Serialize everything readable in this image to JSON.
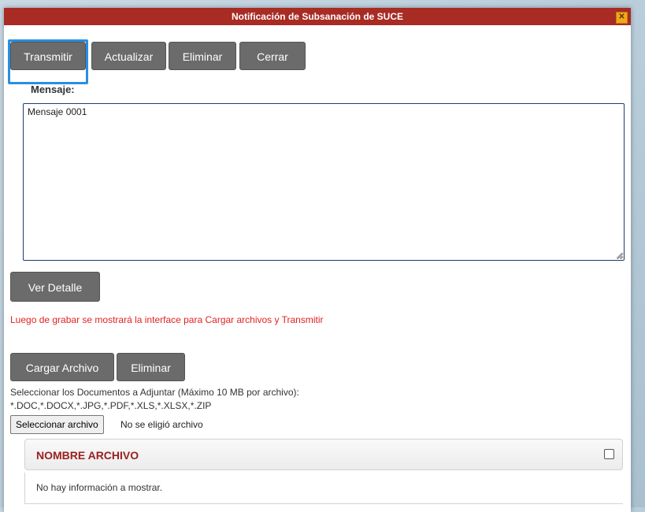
{
  "dialog": {
    "title": "Notificación de Subsanación de SUCE",
    "close_glyph": "✕"
  },
  "toolbar": {
    "transmit_label": "Transmitir",
    "update_label": "Actualizar",
    "delete_label": "Eliminar",
    "close_label": "Cerrar"
  },
  "message": {
    "label": "Mensaje:",
    "value": "Mensaje 0001"
  },
  "details": {
    "button_label": "Ver Detalle",
    "note": "Luego de grabar se mostrará la interface para Cargar archivos y Transmitir"
  },
  "attachments": {
    "upload_label": "Cargar Archivo",
    "delete_label": "Eliminar",
    "instructions": "Seleccionar los Documentos a Adjuntar (Máximo 10 MB por archivo):",
    "extensions": "*.DOC,*.DOCX,*.JPG,*.PDF,*.XLS,*.XLSX,*.ZIP",
    "select_button_label": "Seleccionar archivo",
    "no_file_text": "No se eligió archivo",
    "table_header": "NOMBRE ARCHIVO",
    "empty_text": "No hay información a mostrar."
  },
  "colors": {
    "titlebar": "#a82b24",
    "button": "#6b6b6b",
    "focus": "#2a8ee0",
    "note": "#e22222"
  }
}
